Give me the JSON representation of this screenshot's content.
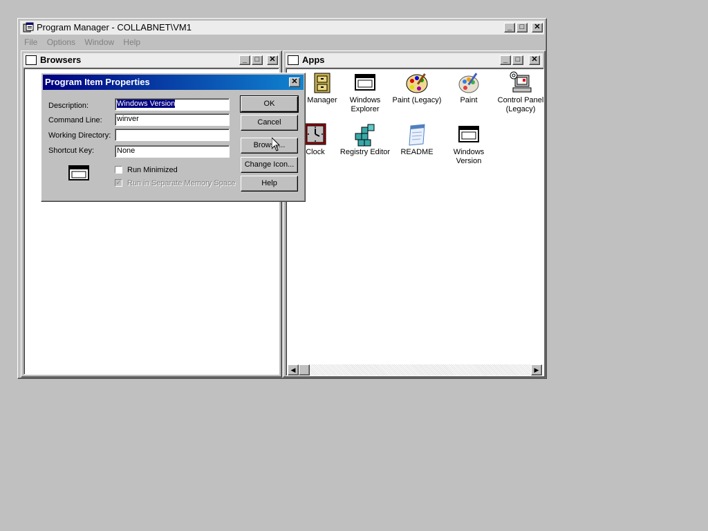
{
  "main_window": {
    "title": "Program Manager - COLLABNET\\VM1",
    "menu": [
      "File",
      "Options",
      "Window",
      "Help"
    ]
  },
  "browsers_window": {
    "title": "Browsers"
  },
  "apps_window": {
    "title": "Apps",
    "icons": [
      {
        "label": "Manager",
        "icon": "file-cabinet-icon"
      },
      {
        "label": "Windows Explorer",
        "icon": "window-icon"
      },
      {
        "label": "Paint (Legacy)",
        "icon": "palette-icon"
      },
      {
        "label": "Paint",
        "icon": "palette-icon"
      },
      {
        "label": "Control Panel (Legacy)",
        "icon": "control-panel-icon"
      },
      {
        "label": "Clock",
        "icon": "clock-icon"
      },
      {
        "label": "Registry Editor",
        "icon": "registry-icon"
      },
      {
        "label": "README",
        "icon": "notepad-icon"
      },
      {
        "label": "Windows Version",
        "icon": "window-icon"
      }
    ]
  },
  "dialog": {
    "title": "Program Item Properties",
    "labels": {
      "description": "Description:",
      "command_line": "Command Line:",
      "working_directory": "Working Directory:",
      "shortcut_key": "Shortcut Key:"
    },
    "values": {
      "description": "Windows Version",
      "command_line": "winver",
      "working_directory": "",
      "shortcut_key": "None"
    },
    "checkboxes": {
      "run_minimized": "Run Minimized",
      "separate_memory": "Run in Separate Memory Space"
    },
    "buttons": {
      "ok": "OK",
      "cancel": "Cancel",
      "browse": "Browse...",
      "change_icon": "Change Icon...",
      "help": "Help"
    }
  },
  "colors": {
    "active_title_start": "#000080",
    "active_title_end": "#1084d0",
    "desktop": "#c0c0c0"
  }
}
